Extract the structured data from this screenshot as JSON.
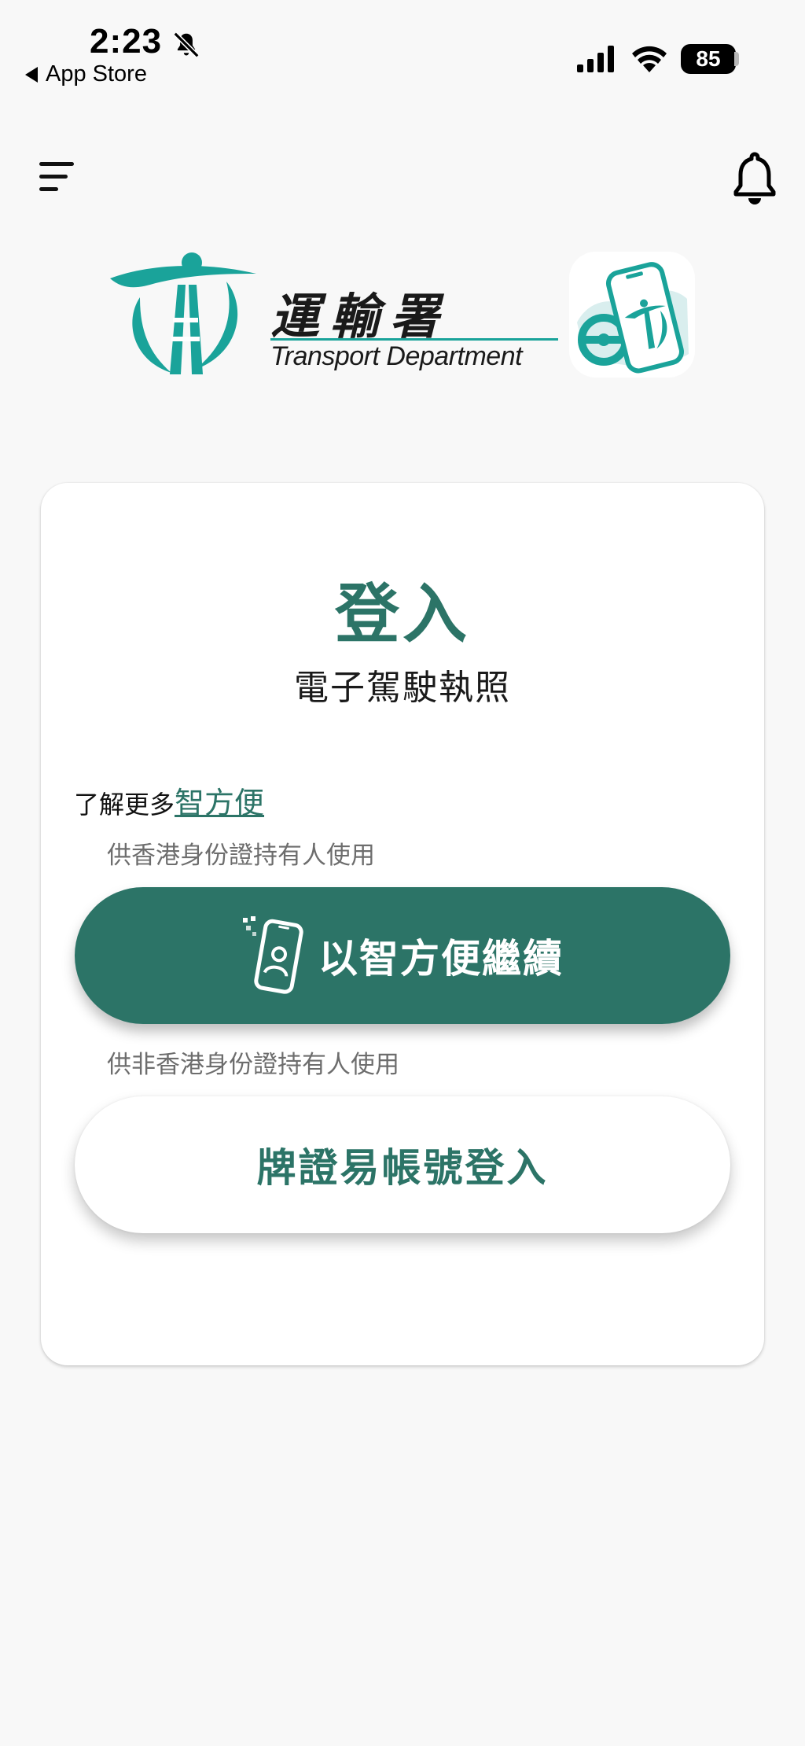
{
  "status_bar": {
    "time": "2:23",
    "back_label": "App Store",
    "battery": "85"
  },
  "logo": {
    "chinese_name": "運輸署",
    "english_name": "Transport Department"
  },
  "login": {
    "title": "登入",
    "subtitle": "電子駕駛執照",
    "learn_more_prefix": "了解更多",
    "learn_more_link": "智方便",
    "hint_hk_id": "供香港身份證持有人使用",
    "iamsmart_button_label": "以智方便繼續",
    "hint_non_hk_id": "供非香港身份證持有人使用",
    "account_button_label": "牌證易帳號登入"
  },
  "colors": {
    "brand_green": "#2c7467",
    "logo_teal": "#1aa39a"
  }
}
